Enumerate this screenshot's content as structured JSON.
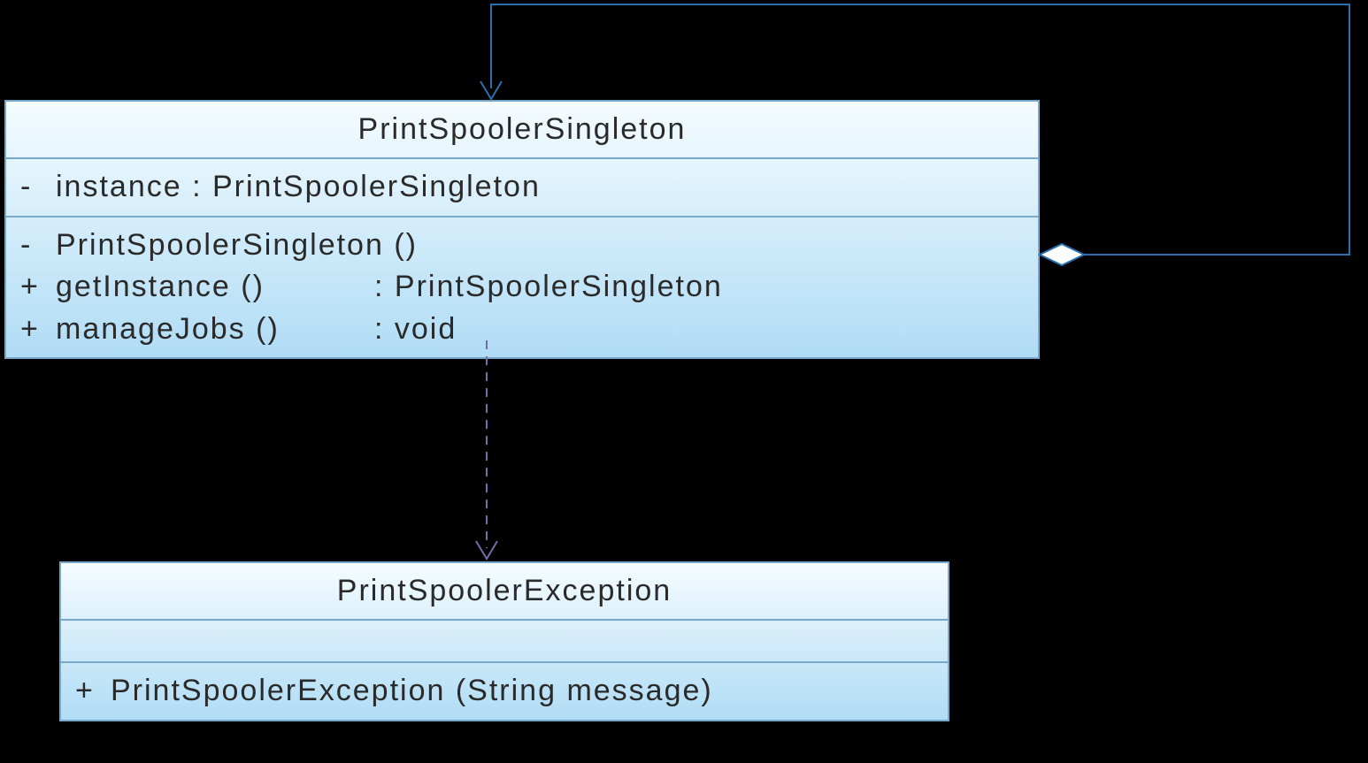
{
  "classes": {
    "singleton": {
      "name": "PrintSpoolerSingleton",
      "attributes": [
        {
          "vis": "-",
          "text": "instance  : PrintSpoolerSingleton"
        }
      ],
      "methods": [
        {
          "vis": "-",
          "name": "PrintSpoolerSingleton ()",
          "ret": ""
        },
        {
          "vis": "+",
          "name": "getInstance ()",
          "ret": ": PrintSpoolerSingleton"
        },
        {
          "vis": "+",
          "name": "manageJobs ()",
          "ret": ": void"
        }
      ]
    },
    "exception": {
      "name": "PrintSpoolerException",
      "methods": [
        {
          "vis": "+",
          "text": "PrintSpoolerException (String message)"
        }
      ]
    }
  },
  "colors": {
    "border": "#7aa8c8",
    "arrowBlue": "#2b6fb0",
    "arrowPurple": "#7a6aa8"
  }
}
